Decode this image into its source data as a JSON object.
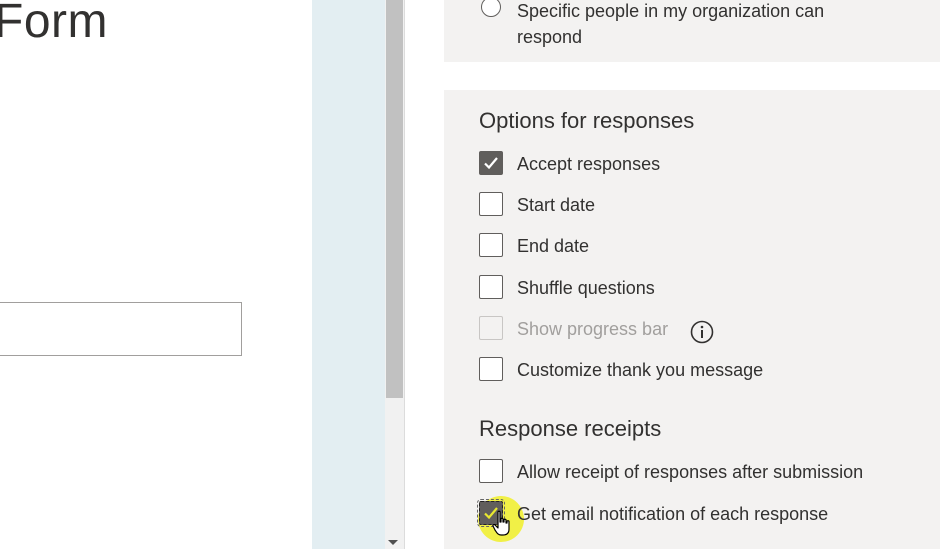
{
  "form": {
    "title": "Form"
  },
  "who_can_respond": {
    "option_label": "Specific people in my organization can respond",
    "selected": false
  },
  "options_for_responses": {
    "title": "Options for responses",
    "items": [
      {
        "label": "Accept responses",
        "checked": true,
        "disabled": false
      },
      {
        "label": "Start date",
        "checked": false,
        "disabled": false
      },
      {
        "label": "End date",
        "checked": false,
        "disabled": false
      },
      {
        "label": "Shuffle questions",
        "checked": false,
        "disabled": false
      },
      {
        "label": "Show progress bar",
        "checked": false,
        "disabled": true,
        "icon": "info-icon"
      },
      {
        "label": "Customize thank you message",
        "checked": false,
        "disabled": false
      }
    ]
  },
  "response_receipts": {
    "title": "Response receipts",
    "items": [
      {
        "label": "Allow receipt of responses after submission",
        "checked": false
      },
      {
        "label": "Get email notification of each response",
        "checked": true,
        "focused": true
      }
    ]
  },
  "cursor": {
    "icon": "hand-pointer-icon",
    "highlight_color": "#f0f028"
  },
  "colors": {
    "card_bg": "#f3f2f1",
    "checkbox_checked": "#605e5c",
    "text": "#323130",
    "disabled_text": "#a19f9d"
  }
}
